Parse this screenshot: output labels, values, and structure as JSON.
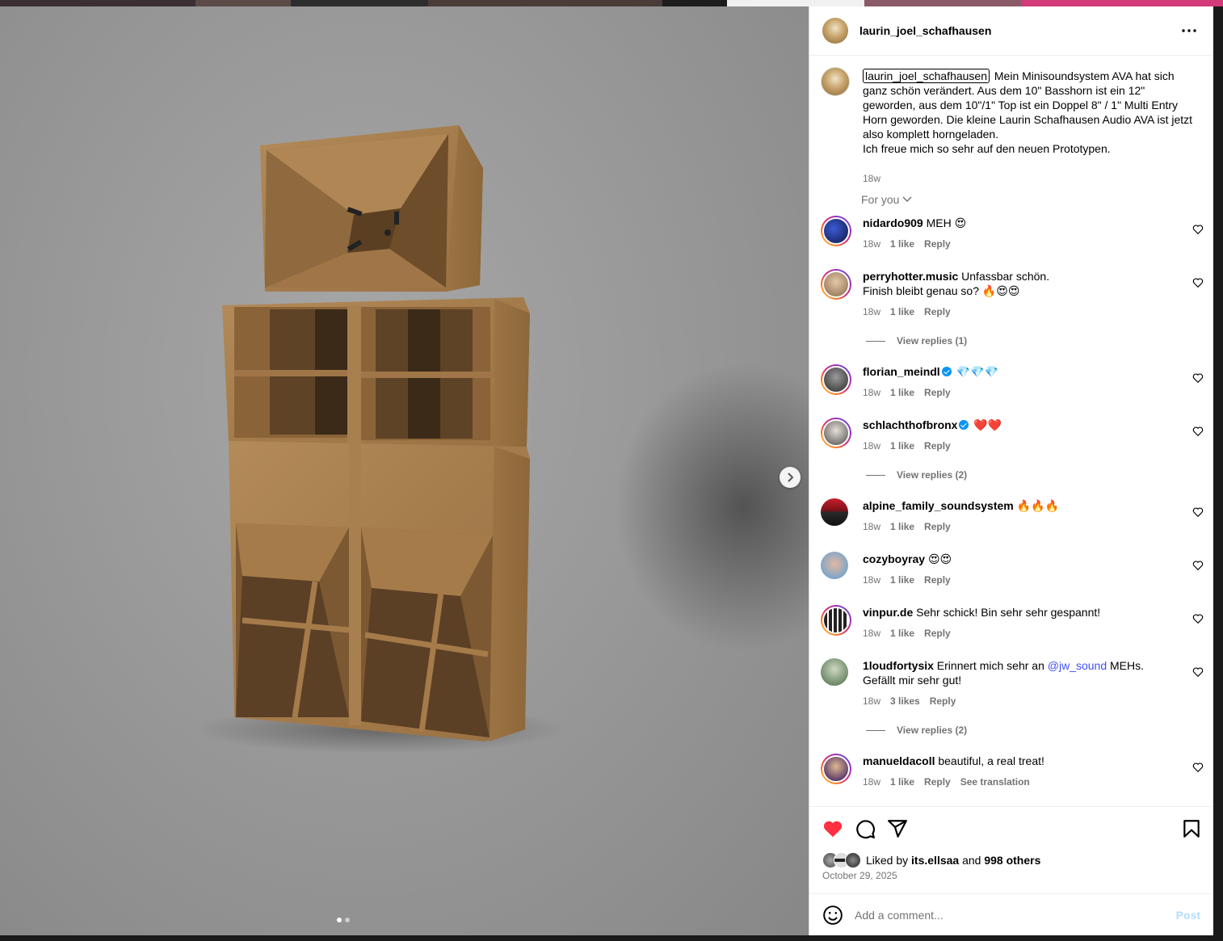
{
  "colors": {
    "accent": "#0095f6",
    "like_red": "#ff3040",
    "meta_gray": "#737373",
    "mention": "#4150f7"
  },
  "post": {
    "username": "laurin_joel_schafhausen",
    "more_icon": "more-horizontal-icon",
    "caption": "Mein Minisoundsystem AVA hat sich ganz schön verändert. Aus dem 10\" Basshorn ist ein 12\" geworden, aus dem 10\"/1\" Top ist ein Doppel 8\" / 1\" Multi Entry Horn geworden. Die kleine Laurin Schafhausen Audio AVA ist jetzt also komplett horngeladen.\nIch freue mich so sehr auf den neuen Prototypen.",
    "caption_time": "18w",
    "sort_label": "For you",
    "liked_by_prefix": "Liked by",
    "liked_by_user": "its.ellsaa",
    "liked_by_and": "and",
    "liked_by_others": "998 others",
    "date": "October 29, 2025",
    "comment_placeholder": "Add a comment...",
    "post_button": "Post",
    "carousel_index": 1,
    "carousel_total": 2
  },
  "comments": [
    {
      "user": "nidardo909",
      "verified": false,
      "text": "MEH 😍",
      "time": "18w",
      "likes": "1 like",
      "reply": "Reply"
    },
    {
      "user": "perryhotter.music",
      "verified": false,
      "text": "Unfassbar schön.\nFinish bleibt genau so? 🔥😍😍",
      "time": "18w",
      "likes": "1 like",
      "reply": "Reply",
      "view_replies": "View replies (1)"
    },
    {
      "user": "florian_meindl",
      "verified": true,
      "text": "💎💎💎",
      "time": "18w",
      "likes": "1 like",
      "reply": "Reply"
    },
    {
      "user": "schlachthofbronx",
      "verified": true,
      "text": "❤️❤️",
      "time": "18w",
      "likes": "1 like",
      "reply": "Reply",
      "view_replies": "View replies (2)"
    },
    {
      "user": "alpine_family_soundsystem",
      "verified": false,
      "text": "🔥🔥🔥",
      "time": "18w",
      "likes": "1 like",
      "reply": "Reply"
    },
    {
      "user": "cozyboyray",
      "verified": false,
      "text": "😍😍",
      "time": "18w",
      "likes": "1 like",
      "reply": "Reply"
    },
    {
      "user": "vinpur.de",
      "verified": false,
      "text": "Sehr schick! Bin sehr sehr gespannt!",
      "time": "18w",
      "likes": "1 like",
      "reply": "Reply"
    },
    {
      "user": "1loudfortysix",
      "verified": false,
      "text_before": "Erinnert mich sehr an",
      "mention": "@jw_sound",
      "text_after": "MEHs. Gefällt mir sehr gut!",
      "time": "18w",
      "likes": "3 likes",
      "reply": "Reply",
      "view_replies": "View replies (2)"
    },
    {
      "user": "manueldacoll",
      "verified": false,
      "text": "beautiful, a real treat!",
      "time": "18w",
      "likes": "1 like",
      "reply": "Reply",
      "translate": "See translation"
    }
  ]
}
